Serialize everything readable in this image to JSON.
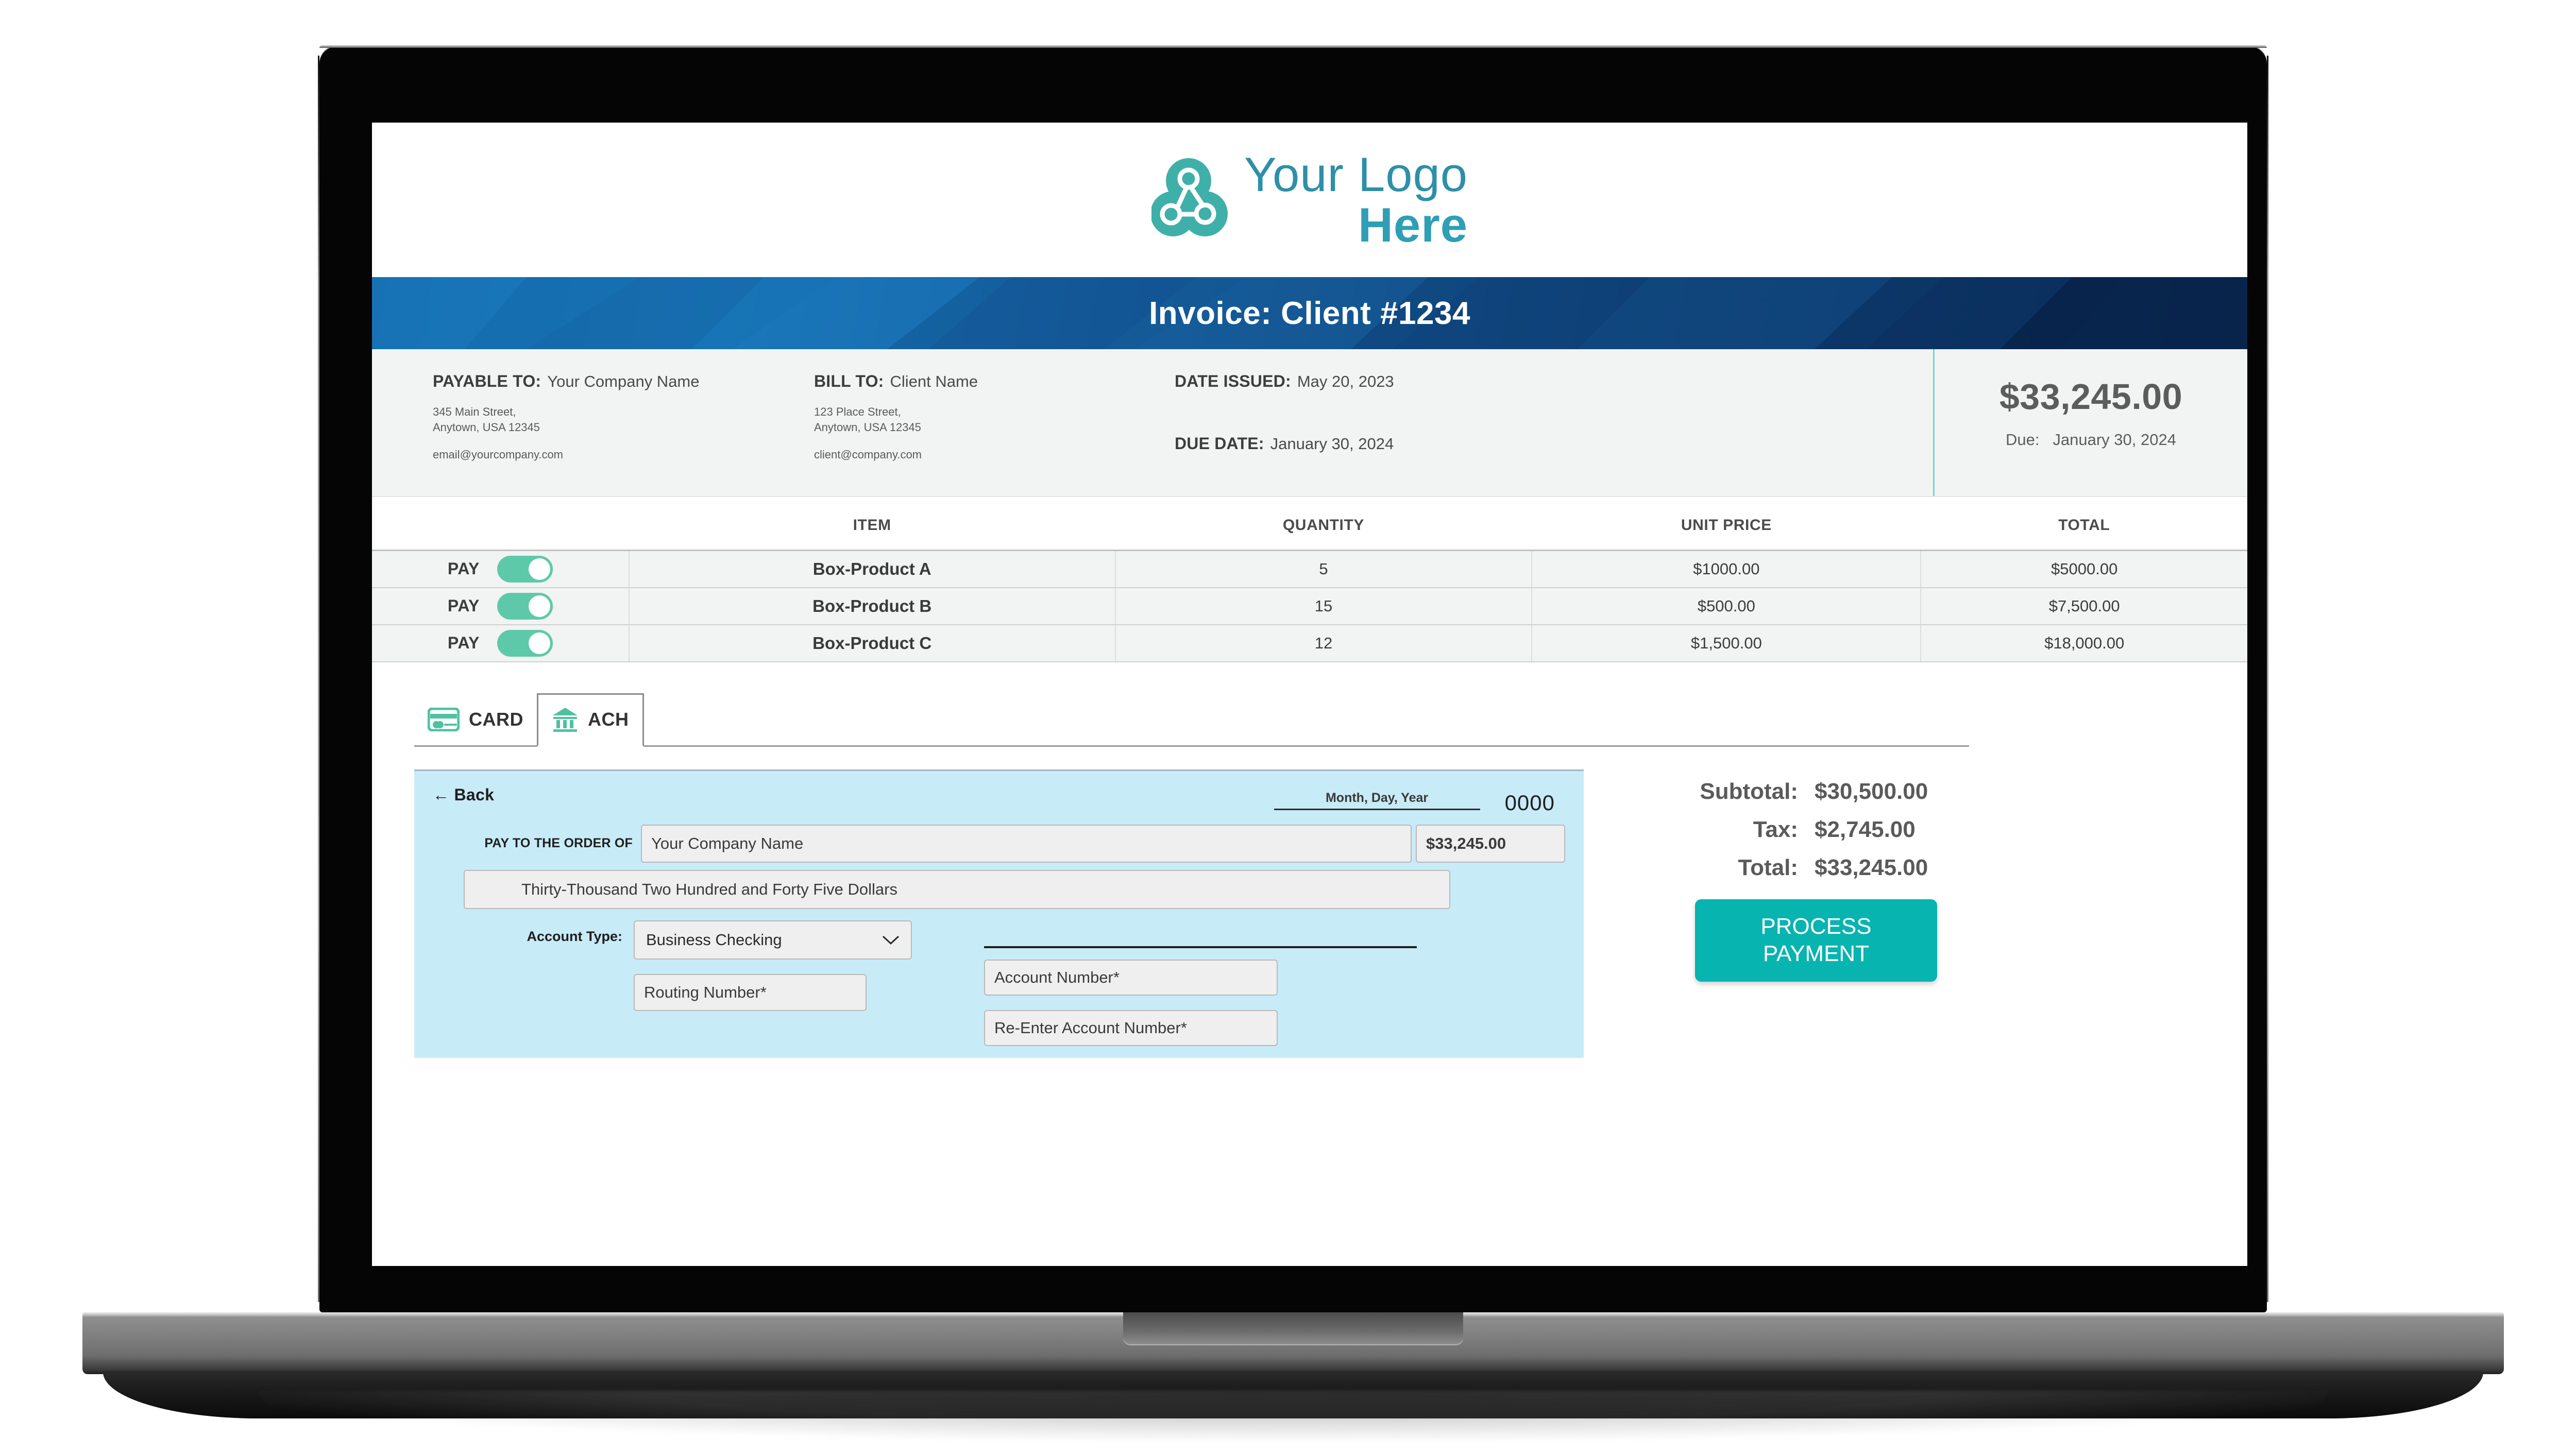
{
  "brand": {
    "logo_line1": "Your Logo",
    "logo_line2": "Here",
    "teal": "#2E9FB5",
    "mint": "#5EC9A8",
    "accent": "#07B4B0",
    "banner_blue": "#1565A8"
  },
  "banner": {
    "title": "Invoice: Client #1234"
  },
  "meta": {
    "payable_label": "PAYABLE TO:",
    "payable_value": "Your Company Name",
    "payable_address_line1": "345 Main Street,",
    "payable_address_line2": "Anytown, USA 12345",
    "payable_email": "email@yourcompany.com",
    "billto_label": "BILL TO:",
    "billto_value": "Client Name",
    "billto_address_line1": "123 Place Street,",
    "billto_address_line2": "Anytown, USA 12345",
    "billto_email": "client@company.com",
    "date_issued_label": "DATE ISSUED:",
    "date_issued_value": "May 20, 2023",
    "due_date_label": "DUE DATE:",
    "due_date_value": "January 30, 2024",
    "amount_due": "$33,245.00",
    "due_prefix": "Due:",
    "due_value": "January 30, 2024"
  },
  "items_table": {
    "columns": [
      "",
      "ITEM",
      "QUANTITY",
      "UNIT PRICE",
      "TOTAL"
    ],
    "pay_label": "PAY",
    "rows": [
      {
        "pay": "PAY",
        "toggle": "on",
        "item": "Box-Product A",
        "quantity": "5",
        "unit_price": "$1000.00",
        "total": "$5000.00"
      },
      {
        "pay": "PAY",
        "toggle": "on",
        "item": "Box-Product B",
        "quantity": "15",
        "unit_price": "$500.00",
        "total": "$7,500.00"
      },
      {
        "pay": "PAY",
        "toggle": "on",
        "item": "Box-Product C",
        "quantity": "12",
        "unit_price": "$1,500.00",
        "total": "$18,000.00"
      }
    ]
  },
  "payment_tabs": [
    {
      "id": "card",
      "label": "CARD",
      "icon": "credit-card-icon",
      "active": false
    },
    {
      "id": "ach",
      "label": "ACH",
      "icon": "bank-icon",
      "active": true
    }
  ],
  "check": {
    "back_label": "Back",
    "back_icon": "arrow-left-icon",
    "date_placeholder": "Month, Day, Year",
    "check_number": "0000",
    "pay_to_order_label": "PAY TO THE ORDER OF",
    "pay_to_value": "Your Company Name",
    "amount_value": "$33,245.00",
    "amount_words": "Thirty-Thousand Two Hundred and Forty Five Dollars",
    "account_type_label": "Account Type:",
    "account_type_value": "Business Checking",
    "routing_placeholder": "Routing Number*",
    "account_placeholder": "Account Number*",
    "account_confirm_placeholder": "Re-Enter Account Number*"
  },
  "summary": {
    "rows": [
      {
        "label": "Subtotal:",
        "value": "$30,500.00"
      },
      {
        "label": "Tax:",
        "value": "$2,745.00"
      },
      {
        "label": "Total:",
        "value": "$33,245.00"
      }
    ],
    "process_button_line1": "PROCESS",
    "process_button_line2": "PAYMENT"
  }
}
